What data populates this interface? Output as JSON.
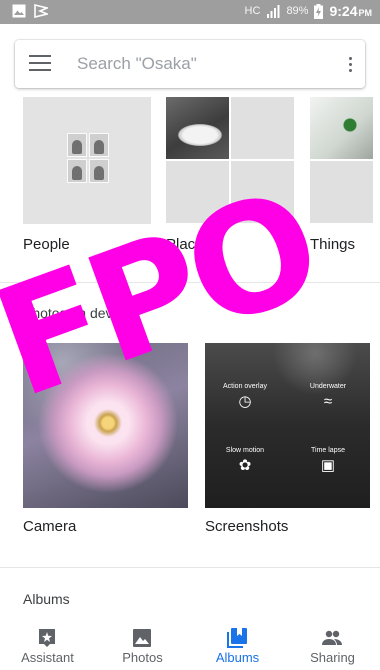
{
  "status_bar": {
    "carrier": "HC",
    "battery": "89%",
    "time": "9:24",
    "ampm": "PM",
    "icons": [
      "image-notification-icon",
      "flag-notification-icon",
      "signal-icon",
      "battery-charging-icon"
    ]
  },
  "search": {
    "placeholder": "Search \"Osaka\""
  },
  "categories": [
    {
      "label": "People"
    },
    {
      "label": "Places"
    },
    {
      "label": "Things"
    }
  ],
  "on_device": {
    "title": "Photos on device",
    "albums": [
      {
        "label": "Camera"
      },
      {
        "label": "Screenshots"
      }
    ],
    "screenshot_preview": [
      {
        "label": "Action overlay",
        "icon": "gauge-icon"
      },
      {
        "label": "Underwater",
        "icon": "water-icon"
      },
      {
        "label": "Slow motion",
        "icon": "runner-icon"
      },
      {
        "label": "Time lapse",
        "icon": "camera-timelapse-icon"
      }
    ]
  },
  "albums_section": {
    "title": "Albums"
  },
  "bottom_nav": [
    {
      "label": "Assistant",
      "icon": "assistant-icon",
      "active": false
    },
    {
      "label": "Photos",
      "icon": "photo-icon",
      "active": false
    },
    {
      "label": "Albums",
      "icon": "albums-icon",
      "active": true
    },
    {
      "label": "Sharing",
      "icon": "people-sharing-icon",
      "active": false
    }
  ],
  "overlay": {
    "text": "FPO"
  },
  "colors": {
    "accent": "#1a73e8",
    "overlay": "#ff00e6",
    "status_bar": "#9e9e9e"
  }
}
